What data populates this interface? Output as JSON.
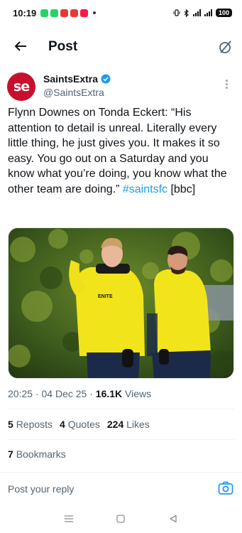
{
  "status_bar": {
    "time": "10:19",
    "battery": "100",
    "app_icon_colors": [
      "#25d366",
      "#25d366",
      "#e53935",
      "#e53935",
      "#ff1744"
    ],
    "icons": [
      "vibrate-icon",
      "bluetooth-icon",
      "signal-icon",
      "5g-signal-icon",
      "battery-icon"
    ]
  },
  "header": {
    "title": "Post",
    "back_icon": "back-arrow-icon",
    "grok_icon": "grok-icon"
  },
  "author": {
    "display_name": "SaintsExtra",
    "handle": "@SaintsExtra",
    "avatar_text": "se",
    "avatar_color": "#c8102e",
    "verified_color": "#1d9bf0"
  },
  "tweet": {
    "text": "Flynn Downes on Tonda Eckert: “His attention to detail is unreal. Literally every little thing, he just gives you. It makes it so easy. You go out on a Saturday and you know what you’re doing, you know what the other team are doing.” ",
    "hashtag": "#saintsfc",
    "suffix": " [bbc]",
    "hashtag_color": "#1d9bf0"
  },
  "media": {
    "shirt_text": "ENITE"
  },
  "meta": {
    "time": "20:25",
    "sep1": " · ",
    "date": "04 Dec 25",
    "sep2": " · ",
    "views_count": "16.1K",
    "views_label": " Views"
  },
  "stats": {
    "reposts_count": "5",
    "reposts_label": "Reposts",
    "quotes_count": "4",
    "quotes_label": "Quotes",
    "likes_count": "224",
    "likes_label": "Likes",
    "bookmarks_count": "7",
    "bookmarks_label": "Bookmarks"
  },
  "reply": {
    "placeholder": "Post your reply"
  },
  "nav": {
    "icons": [
      "menu-icon",
      "home-square-icon",
      "back-triangle-icon"
    ]
  }
}
